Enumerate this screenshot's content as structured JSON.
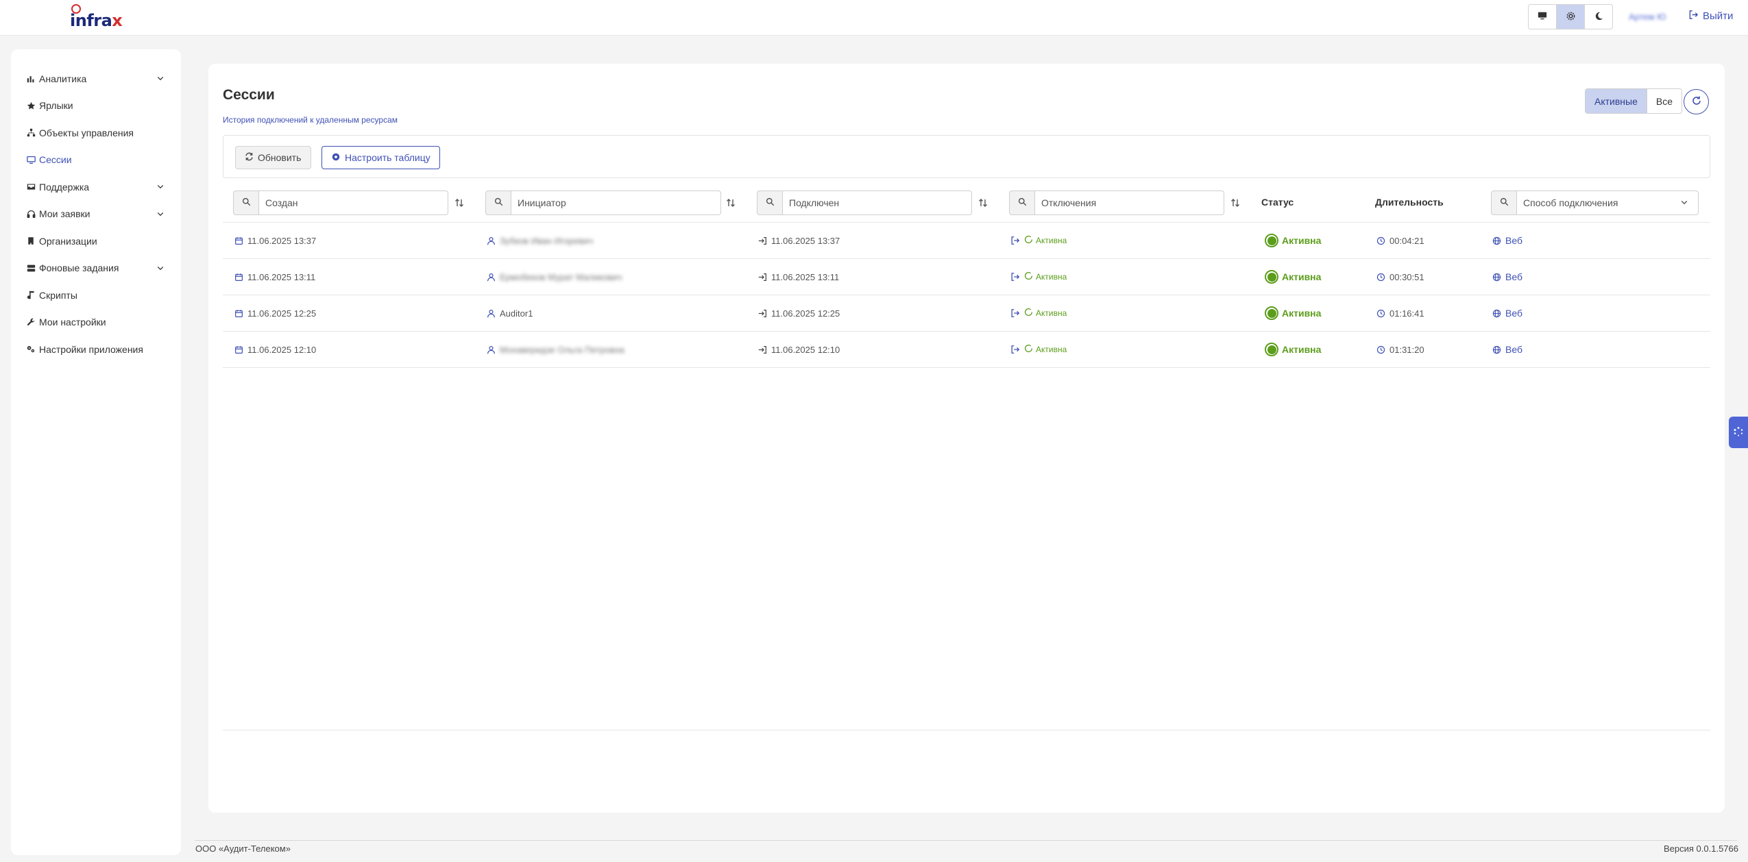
{
  "header": {
    "logo_text": "infrax",
    "user_name": "Артем Ю",
    "logout_label": "Выйти",
    "theme_buttons": [
      "monitor-icon",
      "gear-icon",
      "moon-icon"
    ],
    "active_theme": "gear-icon"
  },
  "sidebar": {
    "items": [
      {
        "label": "Аналитика",
        "icon": "chart-icon",
        "expandable": true
      },
      {
        "label": "Ярлыки",
        "icon": "star-icon",
        "expandable": false
      },
      {
        "label": "Объекты управления",
        "icon": "hierarchy-icon",
        "expandable": false
      },
      {
        "label": "Сессии",
        "icon": "monitor-icon",
        "expandable": false,
        "active": true
      },
      {
        "label": "Поддержка",
        "icon": "inbox-icon",
        "expandable": true
      },
      {
        "label": "Мои заявки",
        "icon": "headset-icon",
        "expandable": true
      },
      {
        "label": "Организации",
        "icon": "building-icon",
        "expandable": false
      },
      {
        "label": "Фоновые задания",
        "icon": "server-icon",
        "expandable": true
      },
      {
        "label": "Скрипты",
        "icon": "script-icon",
        "expandable": false
      },
      {
        "label": "Мои настройки",
        "icon": "wrench-icon",
        "expandable": false
      },
      {
        "label": "Настройки приложения",
        "icon": "gears-icon",
        "expandable": false
      }
    ]
  },
  "main": {
    "title": "Сессии",
    "subtitle": "История подключений к удаленным ресурсам",
    "segments": {
      "active_label": "Активные",
      "all_label": "Все"
    },
    "toolbar": {
      "refresh_label": "Обновить",
      "configure_label": "Настроить таблицу"
    },
    "columns": {
      "created_placeholder": "Создан",
      "initiator_placeholder": "Инициатор",
      "connected_placeholder": "Подключен",
      "disconnected_placeholder": "Отключения",
      "status_label": "Статус",
      "duration_label": "Длительность",
      "method_placeholder": "Способ подключения"
    },
    "rows": [
      {
        "created": "11.06.2025 13:37",
        "initiator": "Зубков Иван Игоревич",
        "initiator_blurred": true,
        "connected": "11.06.2025 13:37",
        "disconnected": "Активна",
        "status": "Активна",
        "duration": "00:04:21",
        "method": "Веб"
      },
      {
        "created": "11.06.2025 13:11",
        "initiator": "Ермобеков Мурат Маликович",
        "initiator_blurred": true,
        "connected": "11.06.2025 13:11",
        "disconnected": "Активна",
        "status": "Активна",
        "duration": "00:30:51",
        "method": "Веб"
      },
      {
        "created": "11.06.2025 12:25",
        "initiator": "Auditor1",
        "initiator_blurred": false,
        "connected": "11.06.2025 12:25",
        "disconnected": "Активна",
        "status": "Активна",
        "duration": "01:16:41",
        "method": "Веб"
      },
      {
        "created": "11.06.2025 12:10",
        "initiator": "Мохаверидзе Ольга Петровна",
        "initiator_blurred": true,
        "connected": "11.06.2025 12:10",
        "disconnected": "Активна",
        "status": "Активна",
        "duration": "01:31:20",
        "method": "Веб"
      }
    ]
  },
  "footer": {
    "company": "ООО «Аудит-Телеком»",
    "version": "Версия 0.0.1.5766"
  },
  "colors": {
    "accent": "#3f51b5",
    "active_status": "#5c9d1c",
    "segment_active_bg": "#c9d2ef"
  }
}
